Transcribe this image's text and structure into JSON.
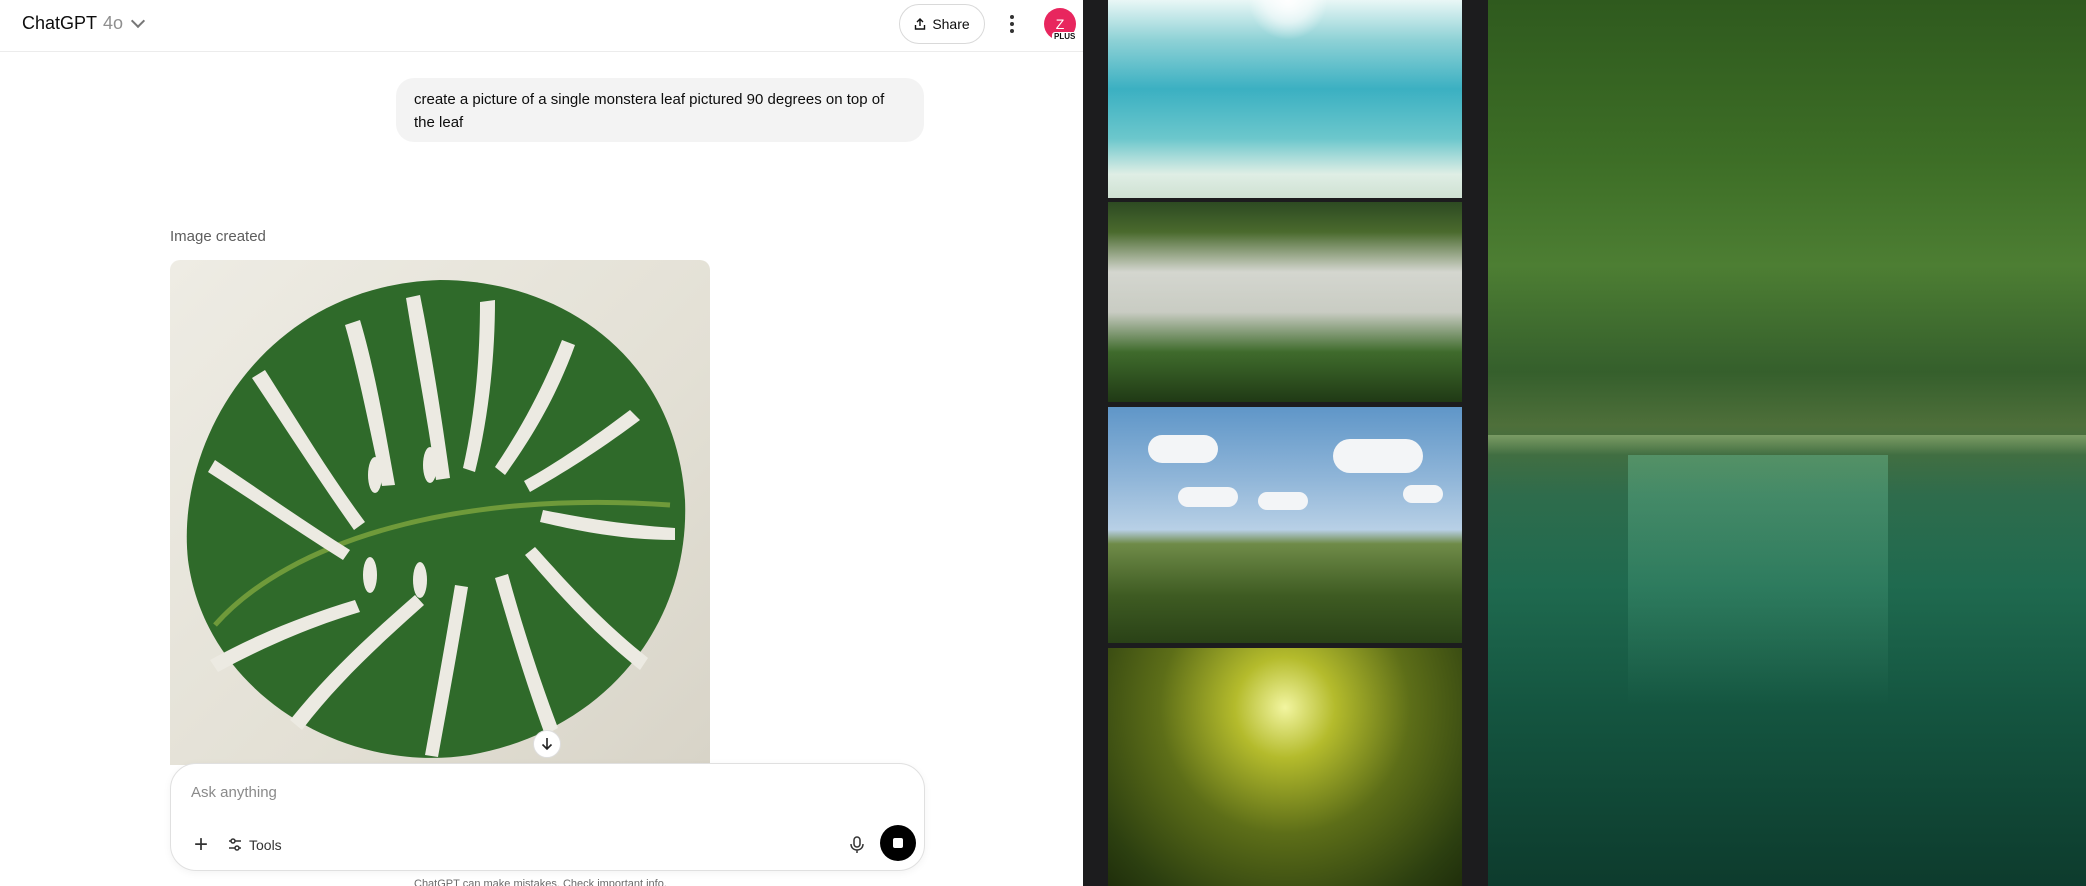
{
  "header": {
    "model_name": "ChatGPT",
    "model_version": "4o",
    "share_label": "Share",
    "avatar_letter": "Z",
    "avatar_badge": "PLUS",
    "avatar_color": "#e8265e"
  },
  "conversation": {
    "user_message": "create a picture of a single monstera leaf pictured 90 degrees on top of the leaf",
    "assistant_status": "Image created"
  },
  "composer": {
    "placeholder": "Ask anything",
    "tools_label": "Tools"
  },
  "footer": {
    "disclaimer": "ChatGPT can make mistakes. Check important info."
  },
  "icons": {
    "share": "share-icon",
    "more": "more-vertical-icon",
    "plus": "plus-icon",
    "tools": "sliders-icon",
    "mic": "microphone-icon",
    "stop": "stop-icon",
    "scroll": "arrow-down-icon"
  }
}
